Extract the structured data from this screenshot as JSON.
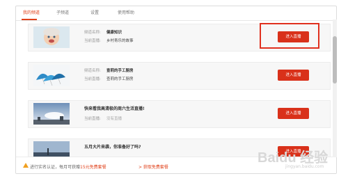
{
  "tabs": [
    {
      "label": "我的频道",
      "active": true
    },
    {
      "label": "子频道",
      "active": false
    },
    {
      "label": "设置",
      "active": false
    },
    {
      "label": "使用帮助",
      "active": false
    }
  ],
  "field_labels": {
    "channel": "频道名称:",
    "current": "当前直播:"
  },
  "channels": [
    {
      "name": "健康知识",
      "current": "乡村青乐的故事",
      "button": "进入直播",
      "thumb_icon": "baby-photo"
    },
    {
      "name": "查莉的手工厨房",
      "current": "查莉的手工厨房",
      "button": "进入直播",
      "thumb_icon": "umbrellas-photo"
    },
    {
      "name": "快来看我高清极的周六生活直播!",
      "current": "没有直播",
      "button": "进入直播",
      "thumb_icon": "sky-city-photo"
    },
    {
      "name": "五月大片来袭，你准备好了吗?",
      "current": "",
      "button": "进入直播",
      "thumb_icon": "landscape-photo"
    }
  ],
  "bottom": {
    "warning_prefix": "进行实名认证，每月可获赠",
    "warning_highlight": "15元免费套餐",
    "link": "> 获取免费套餐"
  },
  "watermark": {
    "text": "Baidu 经验",
    "sub": "jingyan.baidu.com"
  },
  "colors": {
    "accent": "#e0411a",
    "button": "#d9311a",
    "highlight_box": "#e0301e"
  }
}
